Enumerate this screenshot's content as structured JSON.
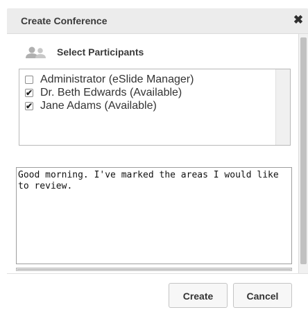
{
  "dialog": {
    "title": "Create Conference",
    "close_icon": "close-icon"
  },
  "participants_section": {
    "icon": "users-icon",
    "label": "Select Participants",
    "items": [
      {
        "label": "Administrator (eSlide Manager)",
        "checked": false
      },
      {
        "label": "Dr. Beth Edwards (Available)",
        "checked": true
      },
      {
        "label": "Jane Adams (Available)",
        "checked": true
      }
    ]
  },
  "message": {
    "value": "Good morning. I've marked the areas I would like to review."
  },
  "buttons": {
    "create_label": "Create",
    "cancel_label": "Cancel"
  }
}
